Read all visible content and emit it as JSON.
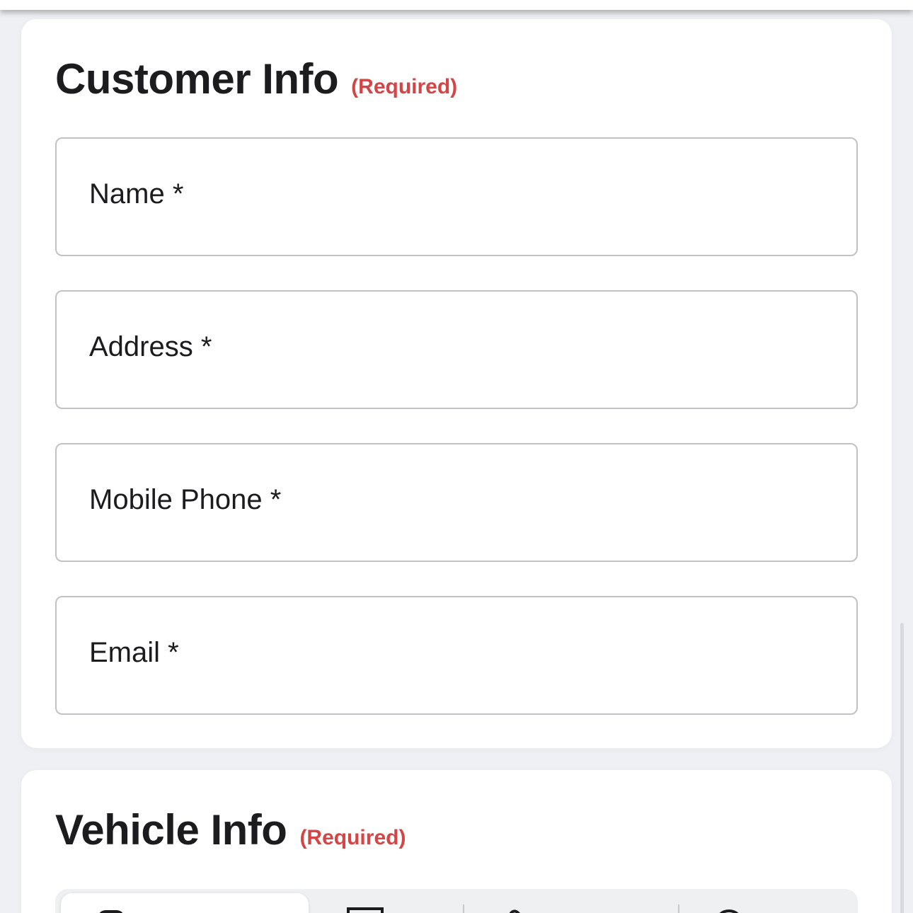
{
  "customer_info": {
    "title": "Customer Info",
    "required_tag": "(Required)",
    "fields": [
      {
        "label": "Name *"
      },
      {
        "label": "Address *"
      },
      {
        "label": "Mobile Phone *"
      },
      {
        "label": "Email *"
      }
    ]
  },
  "vehicle_info": {
    "title": "Vehicle Info",
    "required_tag": "(Required)",
    "tabs": [
      {
        "icon": "car-icon",
        "active": true
      },
      {
        "icon": "vin-card-icon",
        "active": false
      },
      {
        "icon": "wrench-icon",
        "active": false
      },
      {
        "icon": "search-icon",
        "active": false
      }
    ]
  },
  "colors": {
    "required": "#d64545",
    "title": "#1c1c1e",
    "field_border": "#c2c2c6",
    "background": "#eef0f4"
  }
}
